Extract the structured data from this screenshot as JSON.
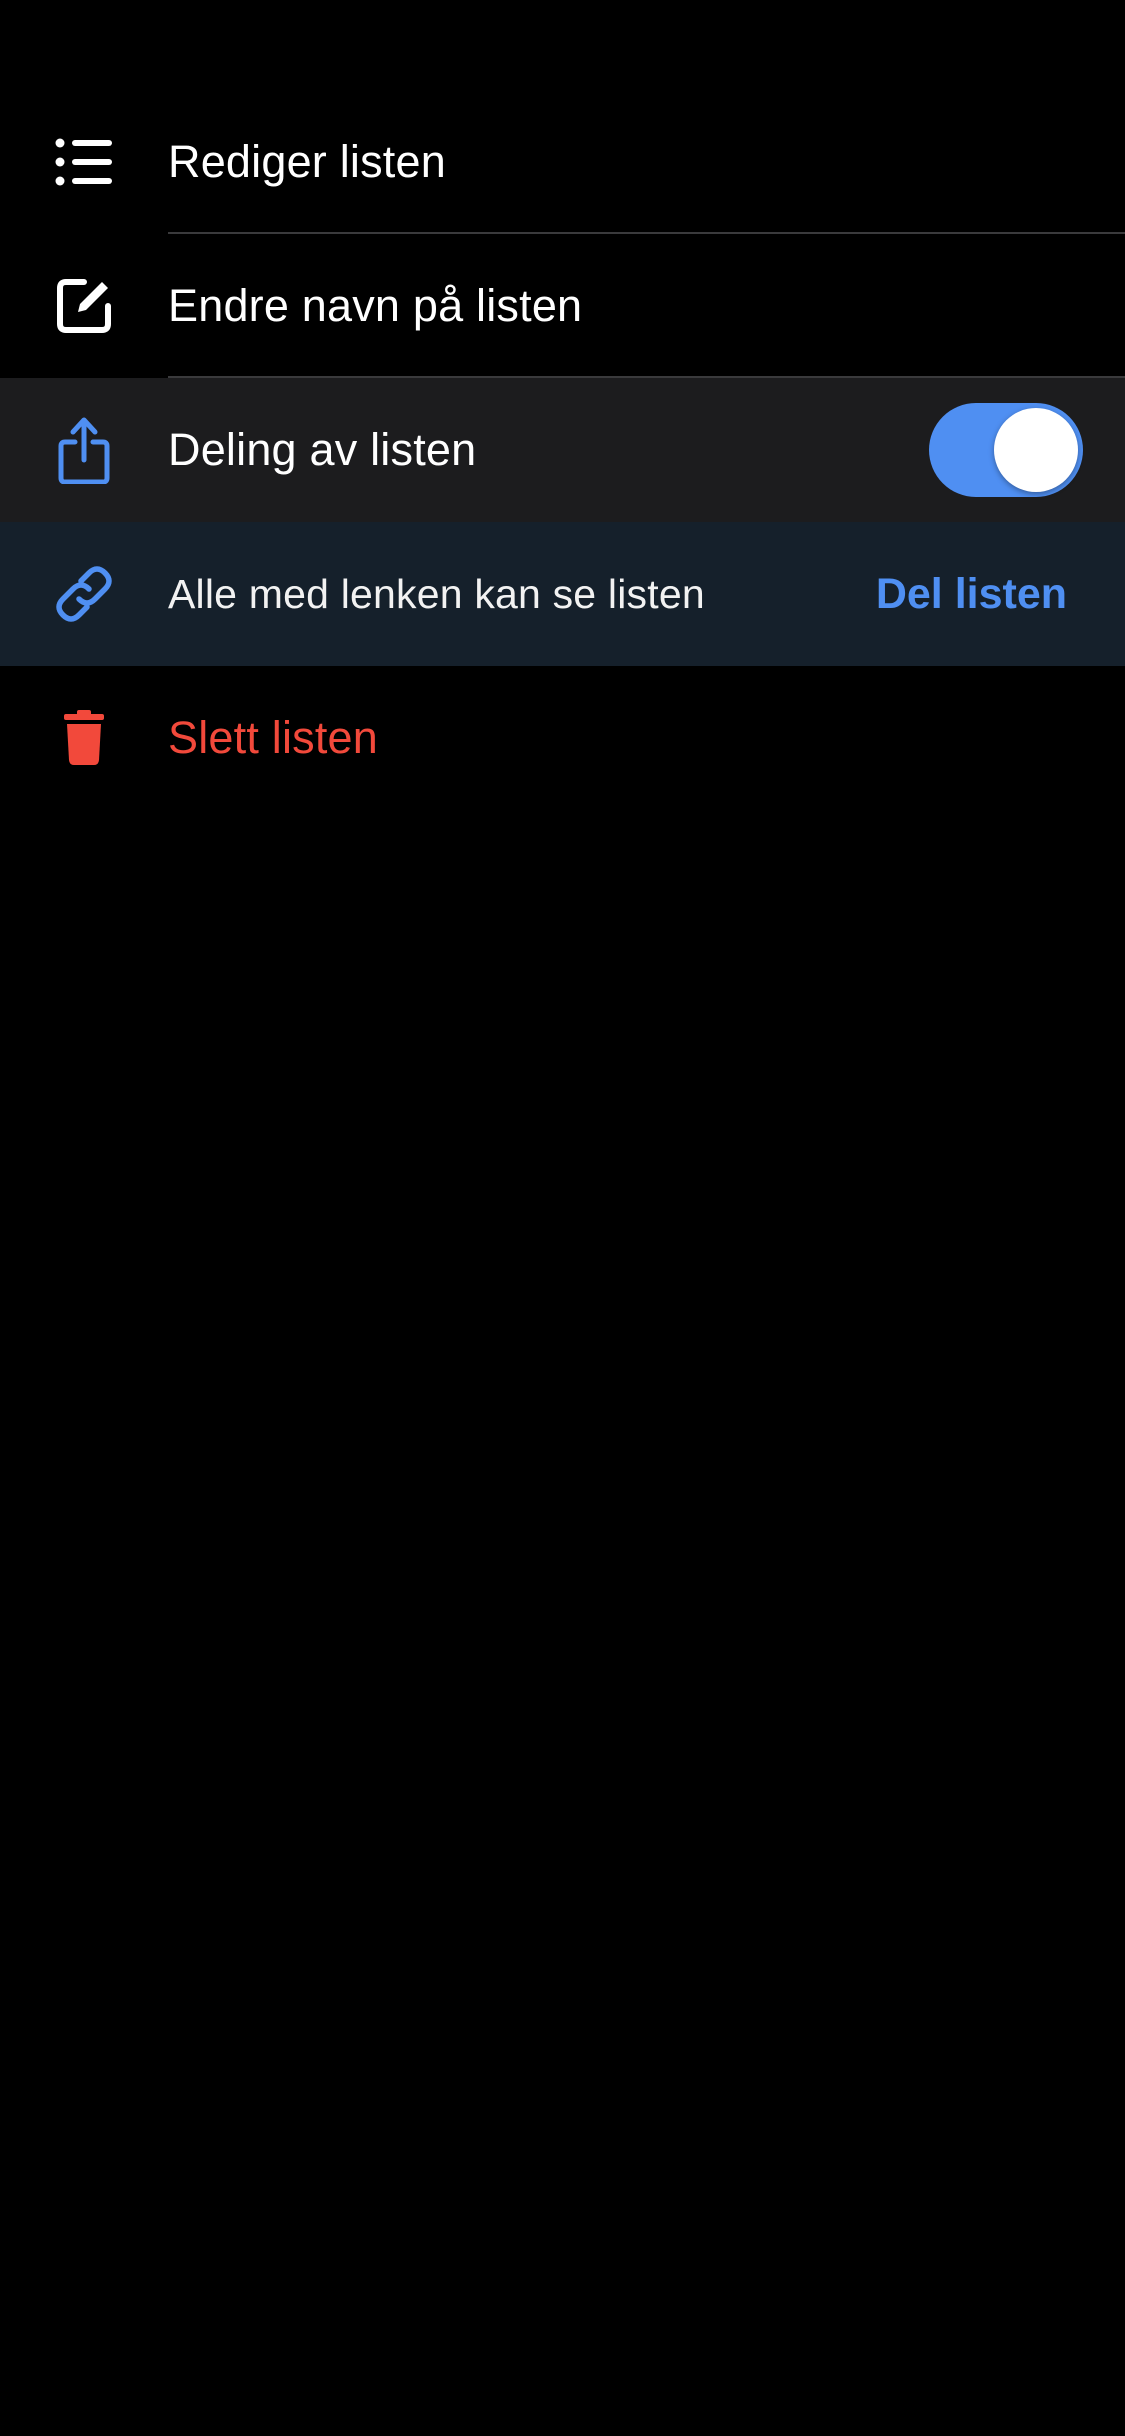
{
  "colors": {
    "accent": "#4f8ff2",
    "danger": "#f2493b",
    "text": "#ffffff",
    "share_row_bg": "#1c1c1e",
    "link_row_bg": "#15202b"
  },
  "menu": {
    "edit_list": {
      "label": "Rediger listen",
      "icon": "list-icon"
    },
    "rename_list": {
      "label": "Endre navn på listen",
      "icon": "edit-square-icon"
    },
    "share_list": {
      "label": "Deling av listen",
      "icon": "share-icon",
      "toggle_on": true
    },
    "link_info": {
      "label": "Alle med lenken kan se listen",
      "icon": "link-icon",
      "action": "Del listen"
    },
    "delete_list": {
      "label": "Slett listen",
      "icon": "trash-icon"
    }
  }
}
